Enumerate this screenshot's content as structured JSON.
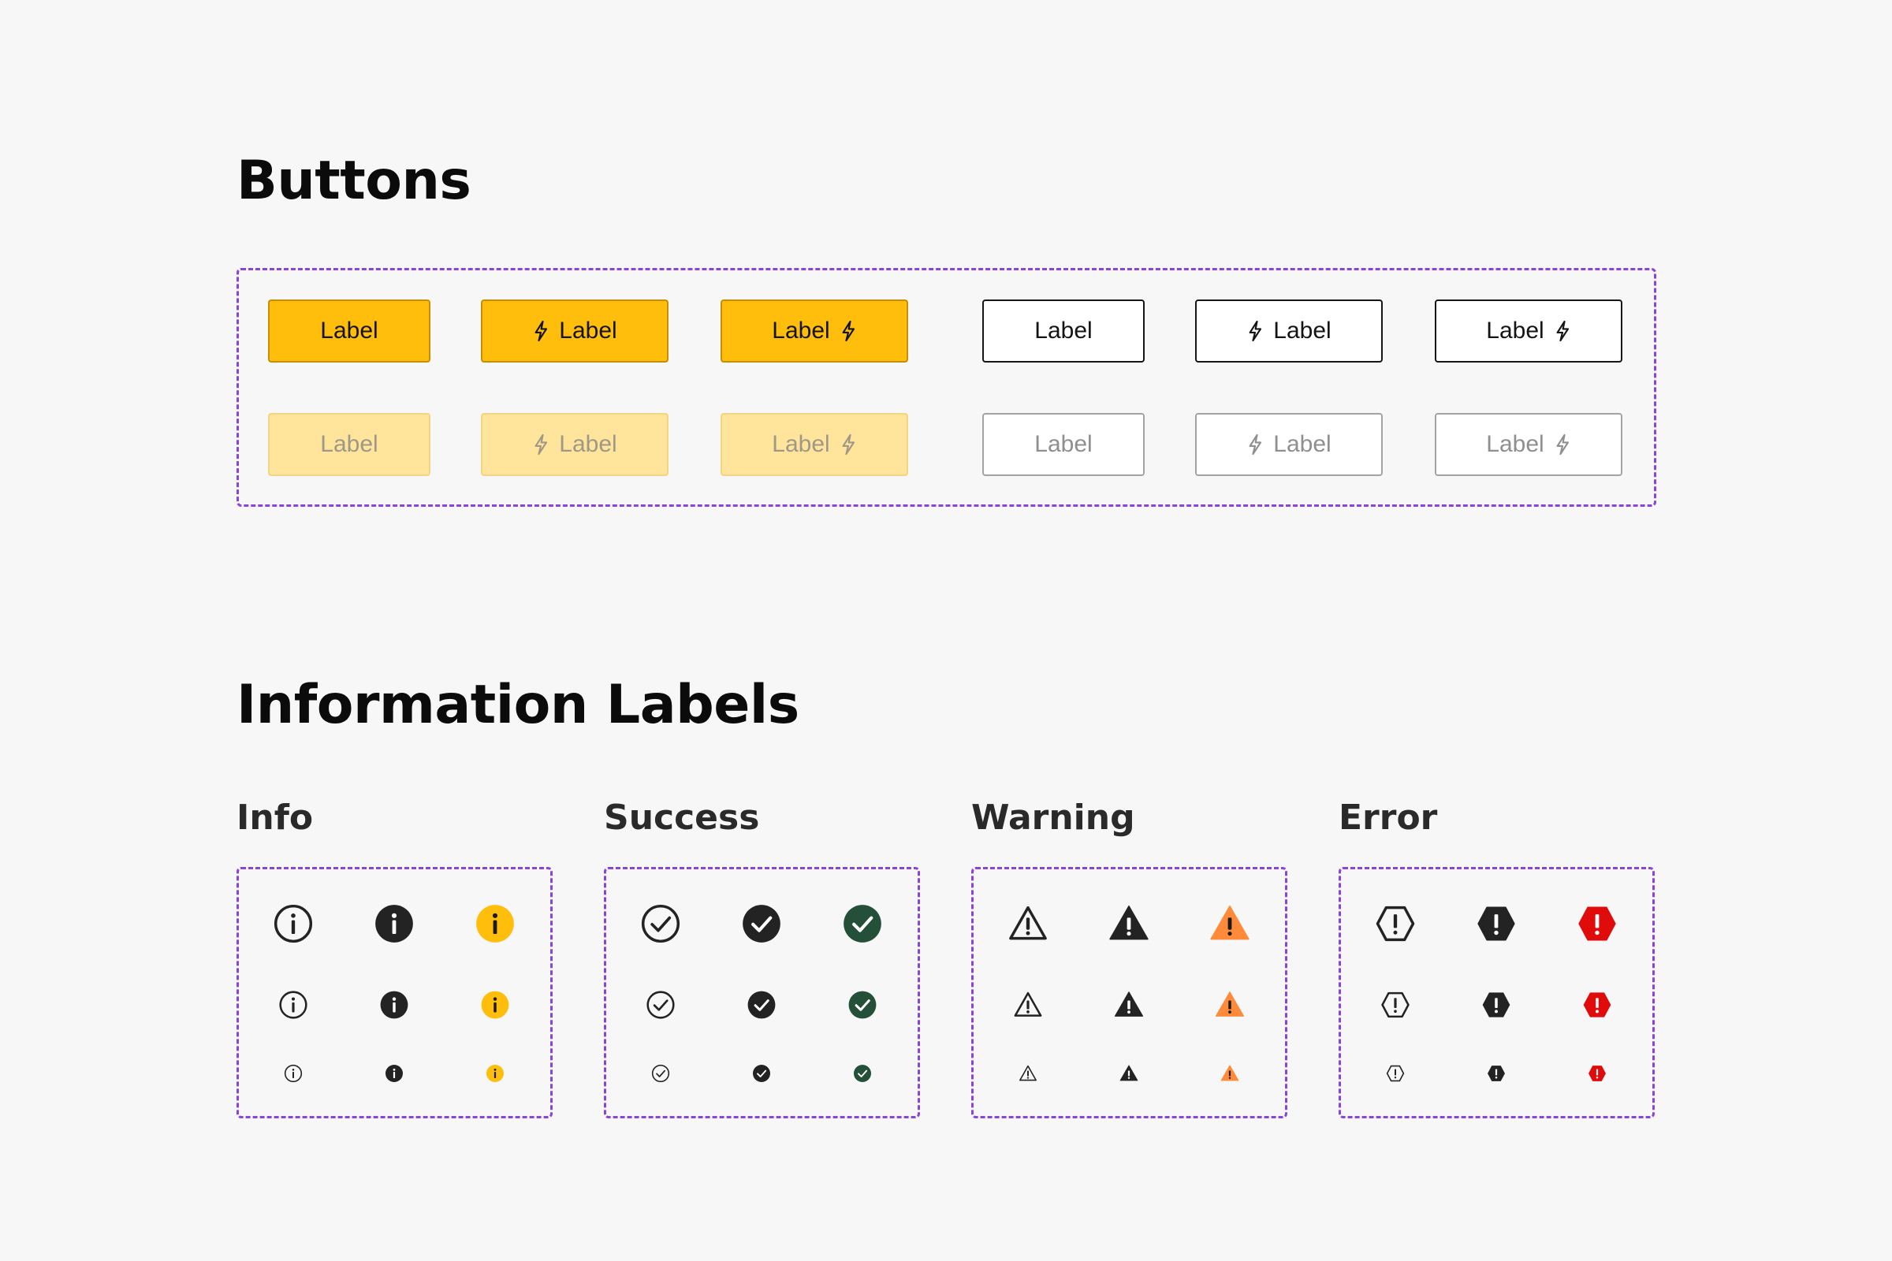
{
  "sections": {
    "buttons_title": "Buttons",
    "info_labels_title": "Information Labels"
  },
  "buttons": {
    "rows": [
      [
        {
          "label": "Label",
          "style": "primary",
          "icon": "none",
          "state": "default"
        },
        {
          "label": "Label",
          "style": "primary",
          "icon": "leading",
          "state": "default"
        },
        {
          "label": "Label",
          "style": "primary",
          "icon": "trailing",
          "state": "default"
        },
        {
          "label": "Label",
          "style": "outline",
          "icon": "none",
          "state": "default"
        },
        {
          "label": "Label",
          "style": "outline",
          "icon": "leading",
          "state": "default"
        },
        {
          "label": "Label",
          "style": "outline",
          "icon": "trailing",
          "state": "default"
        }
      ],
      [
        {
          "label": "Label",
          "style": "primary",
          "icon": "none",
          "state": "disabled"
        },
        {
          "label": "Label",
          "style": "primary",
          "icon": "leading",
          "state": "disabled"
        },
        {
          "label": "Label",
          "style": "primary",
          "icon": "trailing",
          "state": "disabled"
        },
        {
          "label": "Label",
          "style": "outline",
          "icon": "none",
          "state": "disabled"
        },
        {
          "label": "Label",
          "style": "outline",
          "icon": "leading",
          "state": "disabled"
        },
        {
          "label": "Label",
          "style": "outline",
          "icon": "trailing",
          "state": "disabled"
        }
      ]
    ],
    "icon_name": "lightning-icon"
  },
  "info_groups": [
    {
      "title": "Info",
      "icon": "info-icon",
      "sizes": [
        "large",
        "medium",
        "small"
      ],
      "variants": [
        "outline",
        "filled-dark",
        "filled-color"
      ]
    },
    {
      "title": "Success",
      "icon": "check-circle-icon",
      "sizes": [
        "large",
        "medium",
        "small"
      ],
      "variants": [
        "outline",
        "filled-dark",
        "filled-color"
      ]
    },
    {
      "title": "Warning",
      "icon": "warning-triangle-icon",
      "sizes": [
        "large",
        "medium",
        "small"
      ],
      "variants": [
        "outline",
        "filled-dark",
        "filled-color"
      ]
    },
    {
      "title": "Error",
      "icon": "error-octagon-icon",
      "sizes": [
        "large",
        "medium",
        "small"
      ],
      "variants": [
        "outline",
        "filled-dark",
        "filled-color"
      ]
    }
  ],
  "colors": {
    "background": "#f7f7f7",
    "dashed_border": "#8a44d9",
    "primary": "#ffbd0c",
    "primary_disabled": "#ffe59b",
    "dark": "#232323",
    "info": "#ffbd0c",
    "success": "#24503a",
    "warning": "#ff8a3a",
    "error": "#e00b0b"
  }
}
